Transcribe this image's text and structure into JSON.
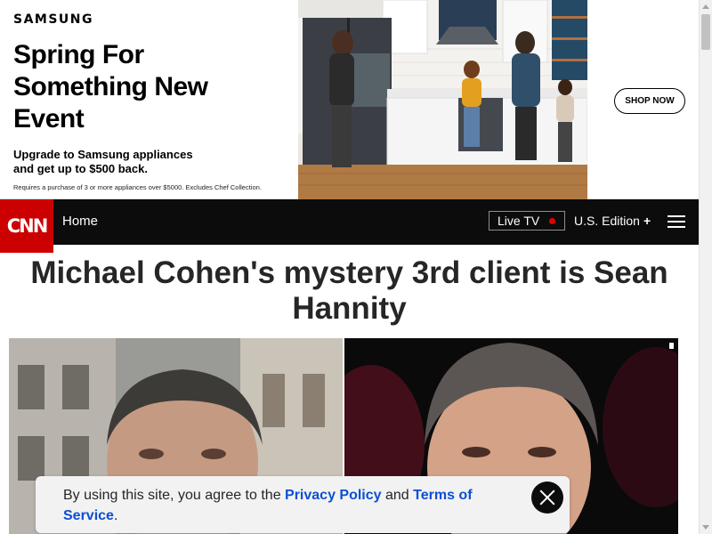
{
  "ad": {
    "brand": "SAMSUNG",
    "headline": "Spring For Something New Event",
    "subtext": "Upgrade to Samsung appliances and get up to $500 back.",
    "fine_print": "Requires a purchase of 3 or more appliances over $5000. Excludes Chef Collection.",
    "cta": "SHOP NOW"
  },
  "nav": {
    "logo_text": "CNN",
    "home": "Home",
    "live_tv": "Live TV",
    "edition": "U.S. Edition",
    "edition_symbol": "+"
  },
  "article": {
    "headline": "Michael Cohen's mystery 3rd client is Sean Hannity"
  },
  "consent": {
    "prefix": "By using this site, you agree to the ",
    "privacy_policy": "Privacy Policy",
    "and": " and ",
    "terms": "Terms of Service",
    "suffix": "."
  },
  "colors": {
    "cnn_red": "#cc0000",
    "nav_bg": "#0c0c0c",
    "link_blue": "#0c4fd4"
  }
}
